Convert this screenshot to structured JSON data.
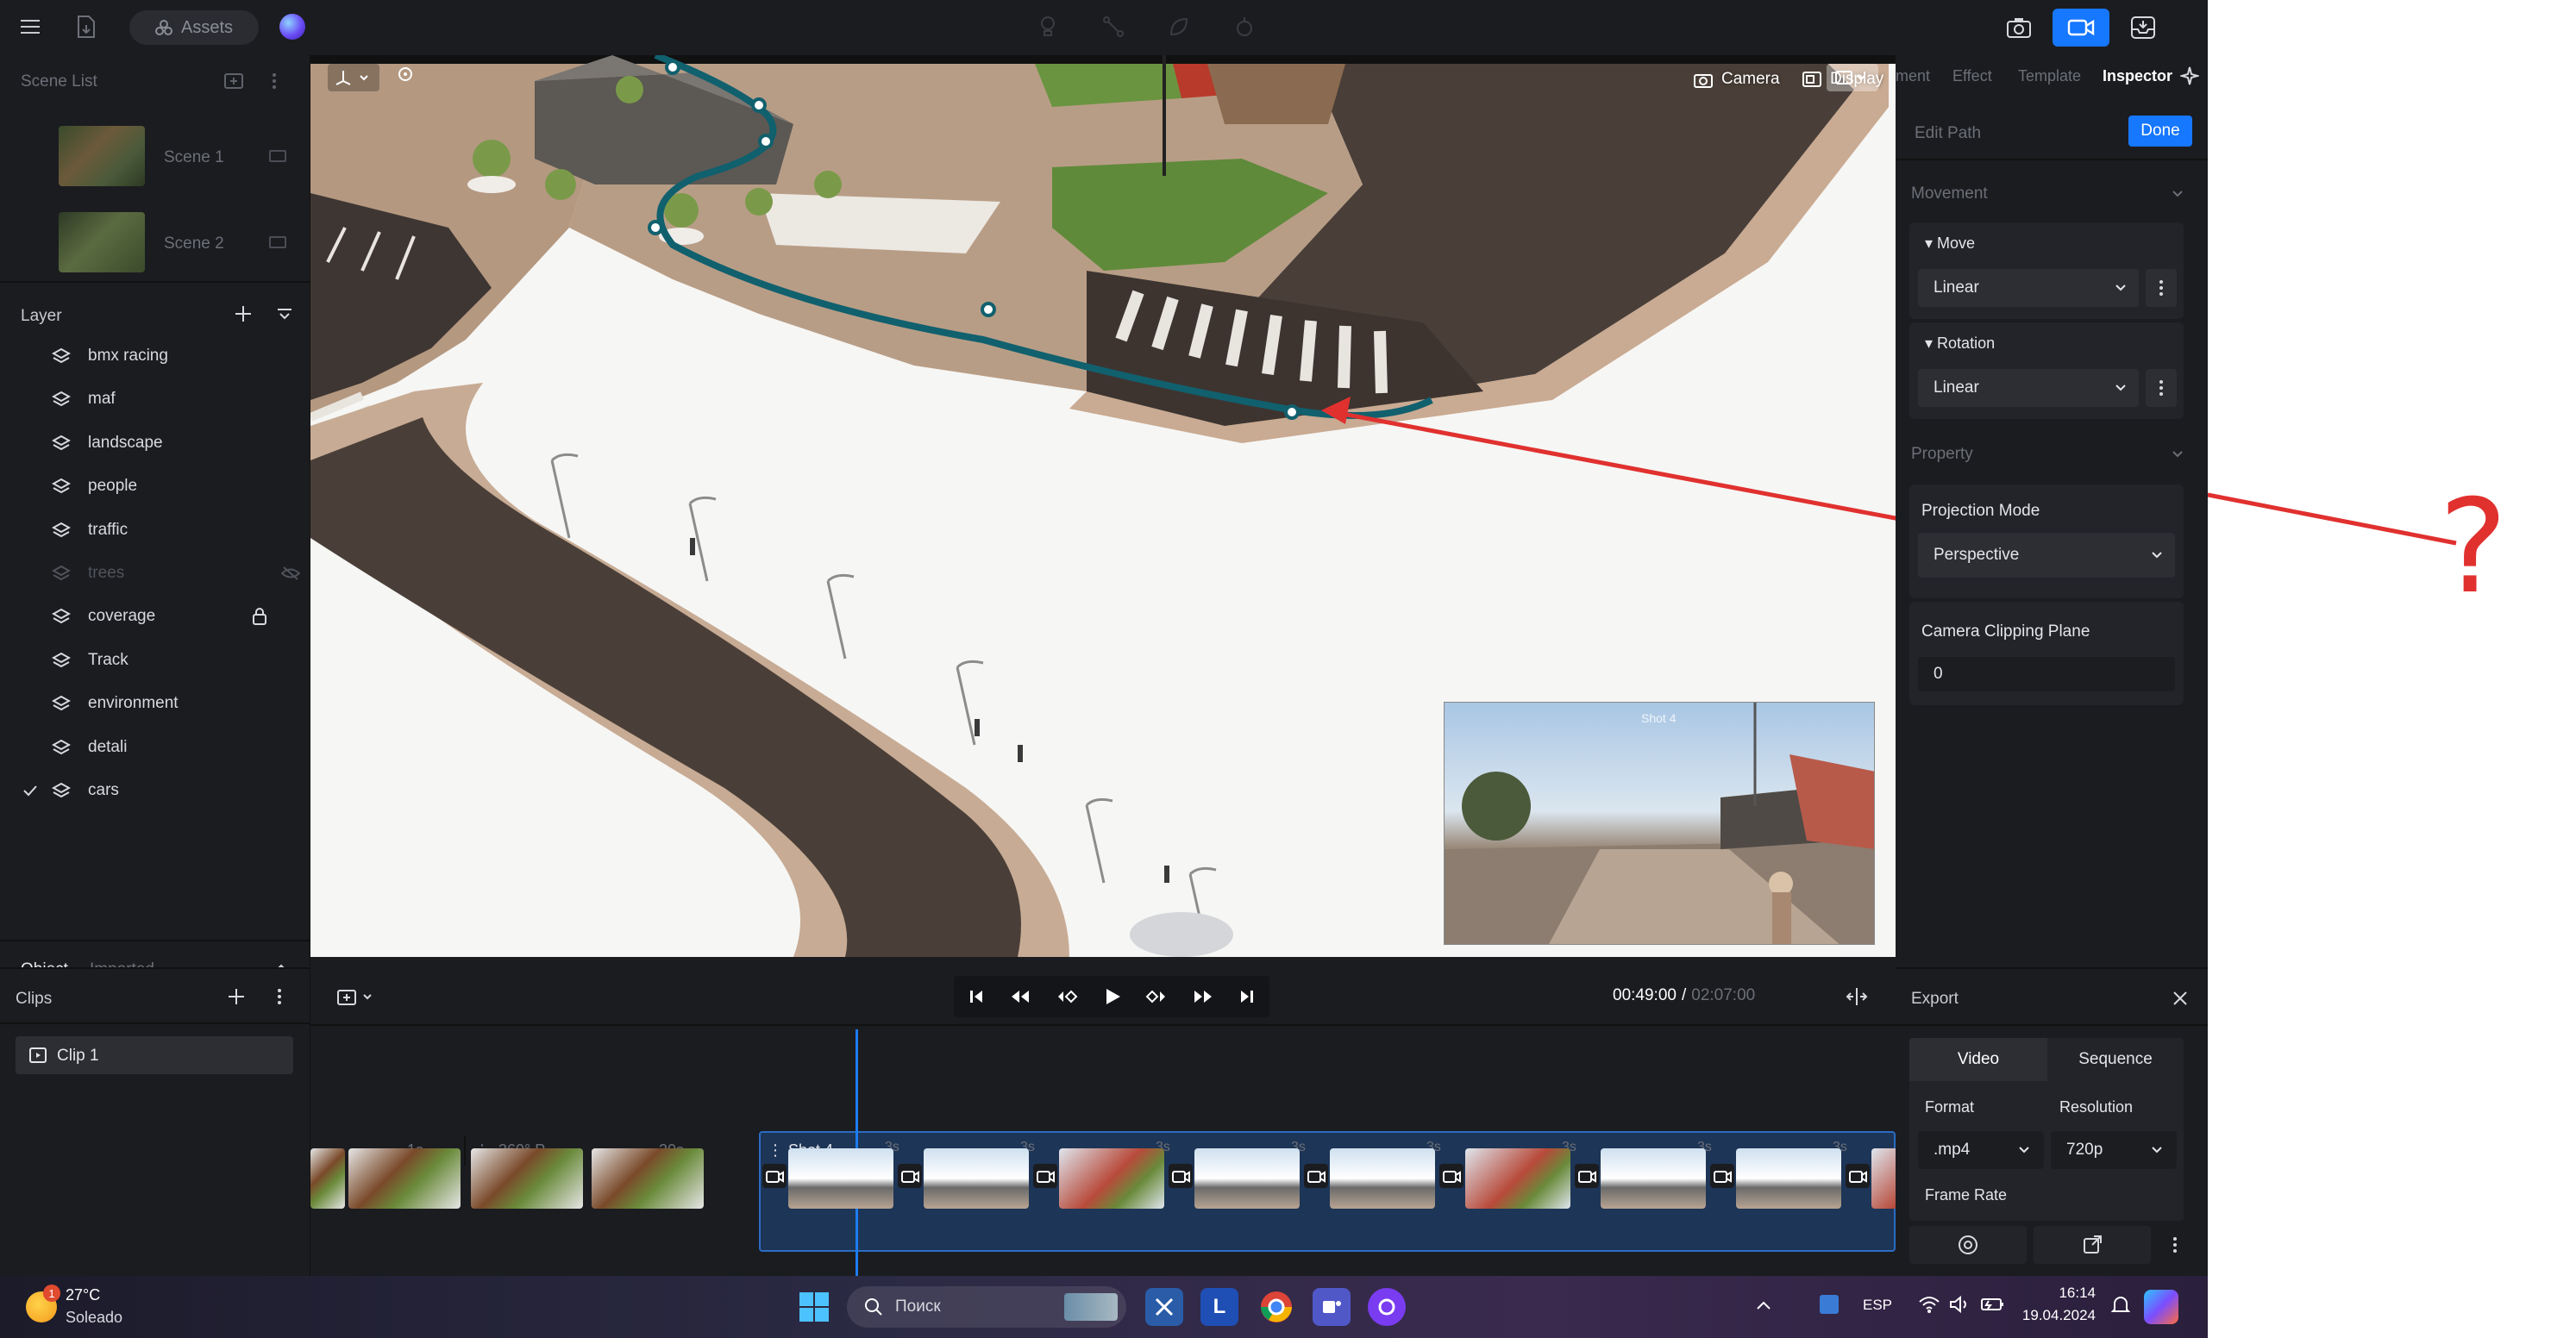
{
  "topbar": {
    "assets_label": "Assets",
    "inspector_tabs": [
      "ment",
      "Effect",
      "Template",
      "Inspector"
    ]
  },
  "scene_list": {
    "title": "Scene List",
    "scenes": [
      {
        "label": "Scene 1"
      },
      {
        "label": "Scene 2"
      }
    ]
  },
  "layers": {
    "title": "Layer",
    "items": [
      {
        "label": "bmx racing",
        "hidden": false,
        "locked": false,
        "checked": false
      },
      {
        "label": "maf",
        "hidden": false,
        "locked": false,
        "checked": false
      },
      {
        "label": "landscape",
        "hidden": false,
        "locked": false,
        "checked": false
      },
      {
        "label": "people",
        "hidden": false,
        "locked": false,
        "checked": false
      },
      {
        "label": "traffic",
        "hidden": false,
        "locked": false,
        "checked": false
      },
      {
        "label": "trees",
        "hidden": true,
        "locked": false,
        "checked": false
      },
      {
        "label": "coverage",
        "hidden": false,
        "locked": true,
        "checked": false
      },
      {
        "label": "Track",
        "hidden": false,
        "locked": false,
        "checked": false
      },
      {
        "label": "environment",
        "hidden": false,
        "locked": false,
        "checked": false
      },
      {
        "label": "detali",
        "hidden": false,
        "locked": false,
        "checked": false
      },
      {
        "label": "cars",
        "hidden": false,
        "locked": false,
        "checked": true
      }
    ]
  },
  "object_tabs": {
    "object": "Object",
    "imported": "Imported"
  },
  "clips": {
    "title": "Clips",
    "items": [
      {
        "label": "Clip 1"
      }
    ]
  },
  "viewport": {
    "camera_label": "Camera",
    "display_label": "Display",
    "preview_label": "Shot 4",
    "annotation": "?"
  },
  "inspector": {
    "edit_path": "Edit Path",
    "done": "Done",
    "movement_title": "Movement",
    "move_label": "Move",
    "move_value": "Linear",
    "rotation_label": "Rotation",
    "rotation_value": "Linear",
    "property_title": "Property",
    "projection_label": "Projection Mode",
    "projection_value": "Perspective",
    "clipping_label": "Camera Clipping Plane",
    "clipping_value": "0"
  },
  "timeline": {
    "current_time": "00:49:00",
    "separator": "/",
    "total_time": "02:07:00",
    "tracks": [
      {
        "label": "1s"
      },
      {
        "label": "360° P..."
      },
      {
        "label": "30s"
      },
      {
        "label": "Shot 4"
      }
    ],
    "durations": [
      "3s",
      "3s",
      "3s",
      "3s",
      "3s",
      "3s",
      "3s",
      "3s",
      "3s"
    ]
  },
  "export": {
    "title": "Export",
    "tab_video": "Video",
    "tab_sequence": "Sequence",
    "format_label": "Format",
    "format_value": ".mp4",
    "resolution_label": "Resolution",
    "resolution_value": "720p",
    "framerate_label": "Frame Rate"
  },
  "taskbar": {
    "temp": "27°C",
    "weather": "Soleado",
    "weather_badge": "1",
    "search_placeholder": "Поиск",
    "lang": "ESP",
    "time": "16:14",
    "date": "19.04.2024"
  },
  "colors": {
    "accent": "#1677ff",
    "path": "#11606e",
    "annotation": "#e0312f",
    "playhead": "#1c7cf2"
  }
}
